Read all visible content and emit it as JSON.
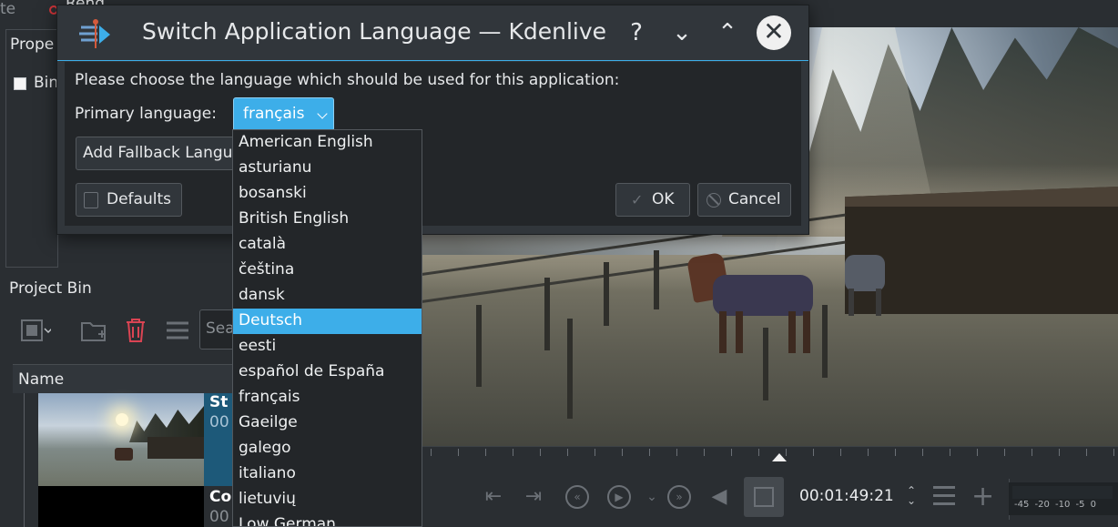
{
  "window": {
    "menu_partial": "te",
    "menu_partial2": "Rend"
  },
  "properties_panel": {
    "title": "Prope",
    "checkbox_label": "Bin"
  },
  "project_bin": {
    "title": "Project Bin",
    "search_placeholder": "Sea",
    "column_name": "Name",
    "clips": [
      {
        "name": "St",
        "sub": "00"
      },
      {
        "name": "Co",
        "sub": "00"
      }
    ]
  },
  "monitor": {
    "timecode": "00:01:49:21",
    "vu_scale": "-45 -20 -10 -5 0"
  },
  "dialog": {
    "title": "Switch Application Language — Kdenlive",
    "help_glyph": "?",
    "minimize_glyph": "⌄",
    "maximize_glyph": "⌃",
    "close_glyph": "✕",
    "prompt": "Please choose the language which should be used for this application:",
    "primary_label": "Primary language:",
    "primary_value": "français",
    "fallback_button": "Add Fallback Language",
    "defaults_button": "Defaults",
    "ok_button": "OK",
    "cancel_button": "Cancel",
    "accent_color": "#3daee9"
  },
  "languages": {
    "selected_index": 7,
    "options": [
      "American English",
      "asturianu",
      "bosanski",
      "British English",
      "català",
      "čeština",
      "dansk",
      "Deutsch",
      "eesti",
      "español de España",
      "français",
      "Gaeilge",
      "galego",
      "italiano",
      "lietuvių",
      "Low German"
    ]
  }
}
